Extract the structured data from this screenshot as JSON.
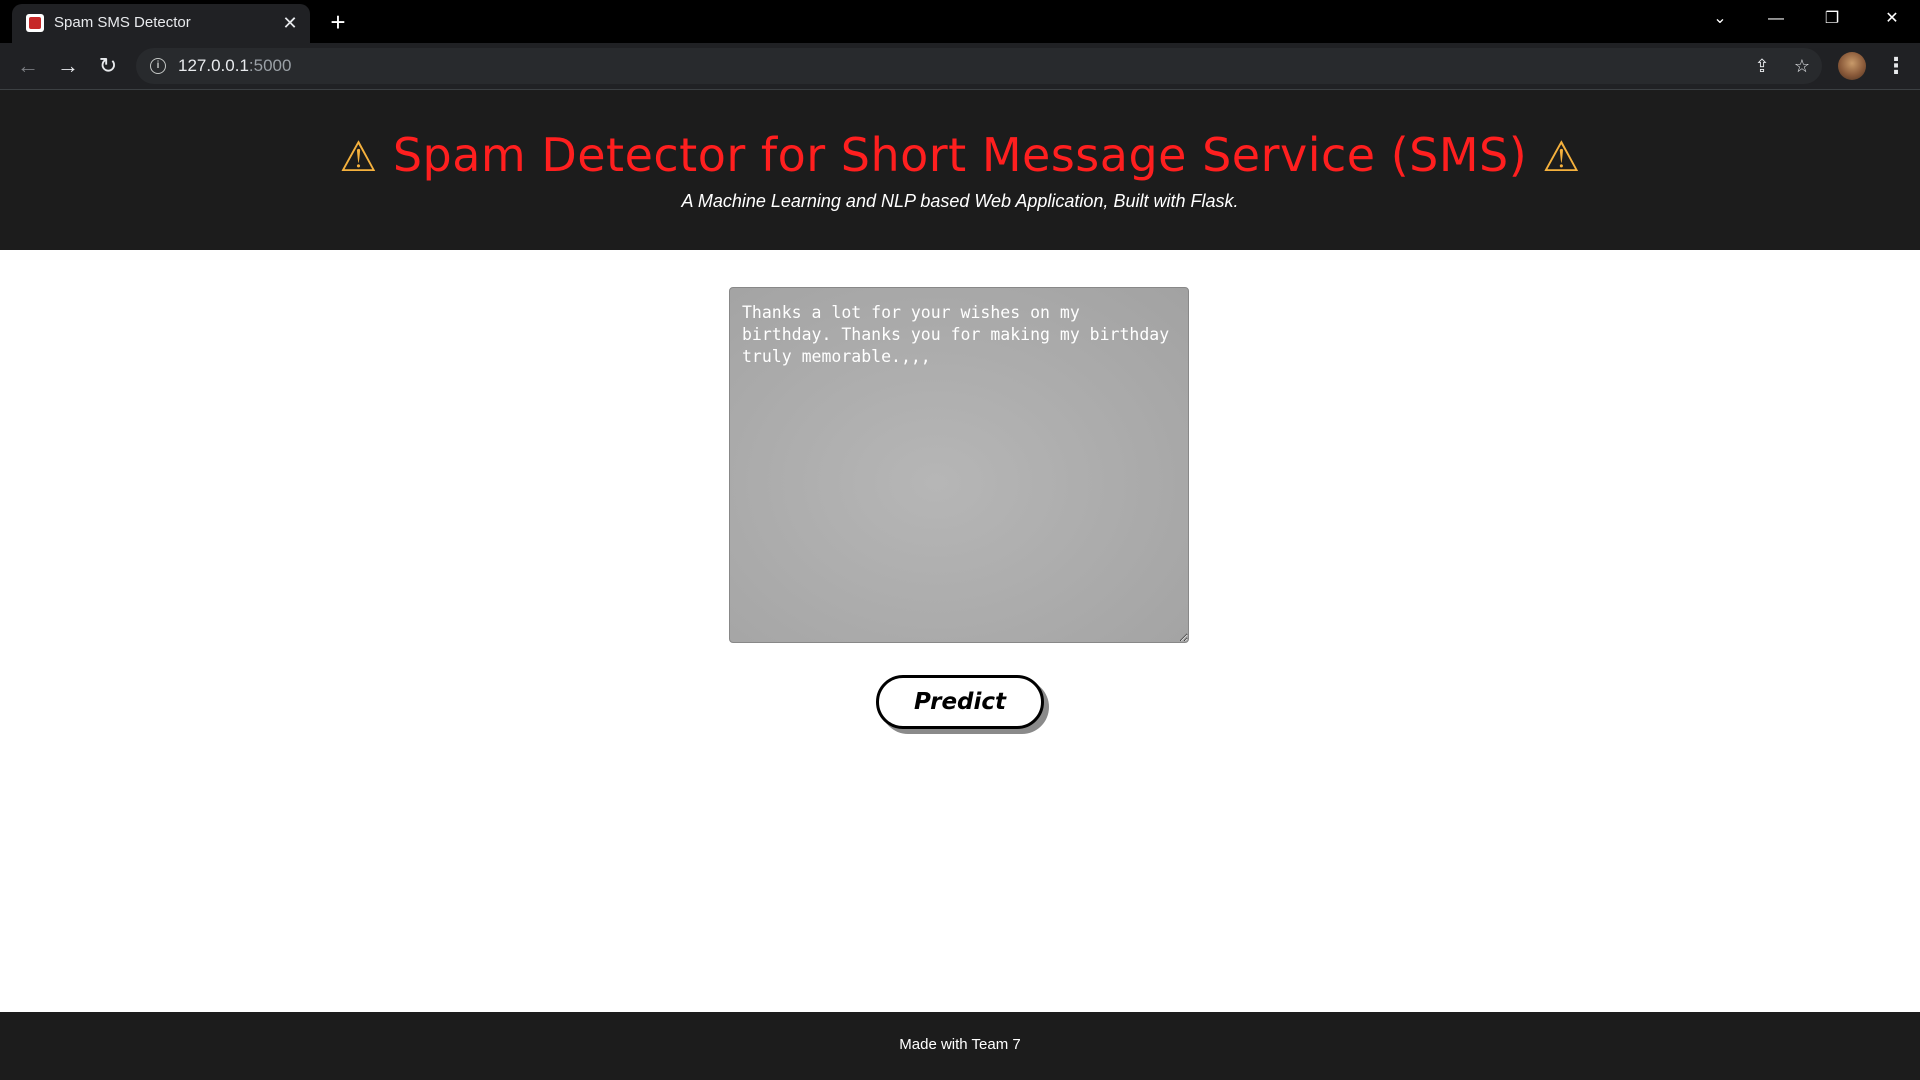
{
  "browser": {
    "tab_title": "Spam SMS Detector",
    "tab_close": "✕",
    "new_tab": "+",
    "url_host": "127.0.0.1",
    "url_port": ":5000",
    "icons": {
      "back": "←",
      "forward": "→",
      "reload": "↻",
      "share": "⇪",
      "star": "☆",
      "menu": "⋮",
      "tab_search": "⌄",
      "minimize": "—",
      "restore": "❐",
      "close": "✕"
    }
  },
  "header": {
    "warning_glyph": "⚠",
    "title": "Spam Detector for Short Message Service (SMS)",
    "subtitle": "A Machine Learning and NLP based Web Application, Built with Flask.",
    "title_color": "#ff1f1f",
    "warning_color": "#f5b13d"
  },
  "form": {
    "message_value": "Thanks a lot for your wishes on my birthday. Thanks you for making my birthday truly memorable.,,,",
    "predict_label": "Predict"
  },
  "footer": {
    "text": "Made with Team 7"
  }
}
